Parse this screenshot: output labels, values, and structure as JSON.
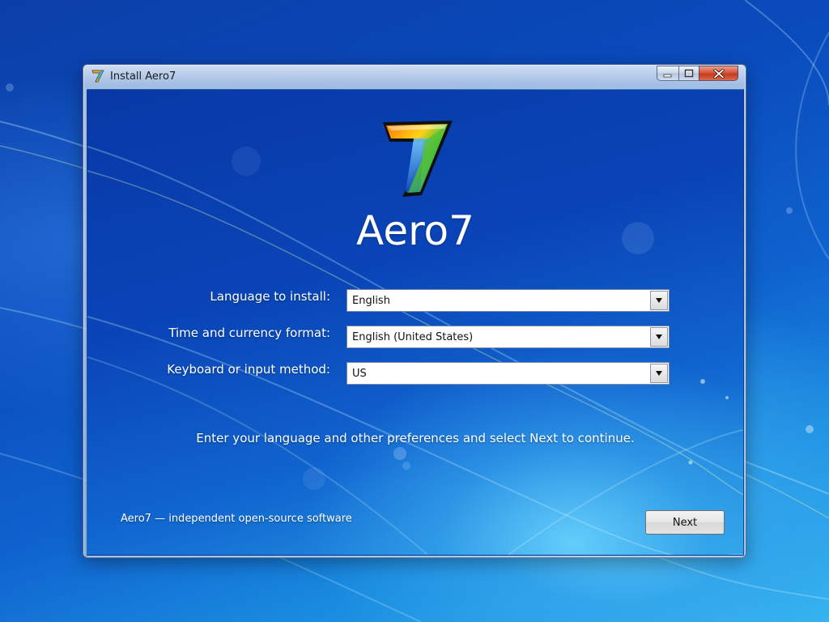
{
  "window": {
    "title": "Install Aero7",
    "icon": "aero7-logo-icon",
    "controls": {
      "minimize": "minimize-icon",
      "maximize": "maximize-icon",
      "close": "close-icon"
    }
  },
  "app": {
    "name": "Aero7",
    "logo_glyph": "7"
  },
  "form": {
    "language": {
      "label": "Language to install:",
      "value": "English"
    },
    "time_currency": {
      "label": "Time and currency format:",
      "value": "English (United States)"
    },
    "keyboard": {
      "label": "Keyboard or input method:",
      "value": "US"
    }
  },
  "instructions": "Enter your language and other preferences and select Next to continue.",
  "footer": {
    "notice": "Aero7 — independent open-source software",
    "next_label": "Next"
  },
  "colors": {
    "background": "#0a4bbd",
    "close_button": "#c43a1d",
    "text": "#ffffff"
  }
}
